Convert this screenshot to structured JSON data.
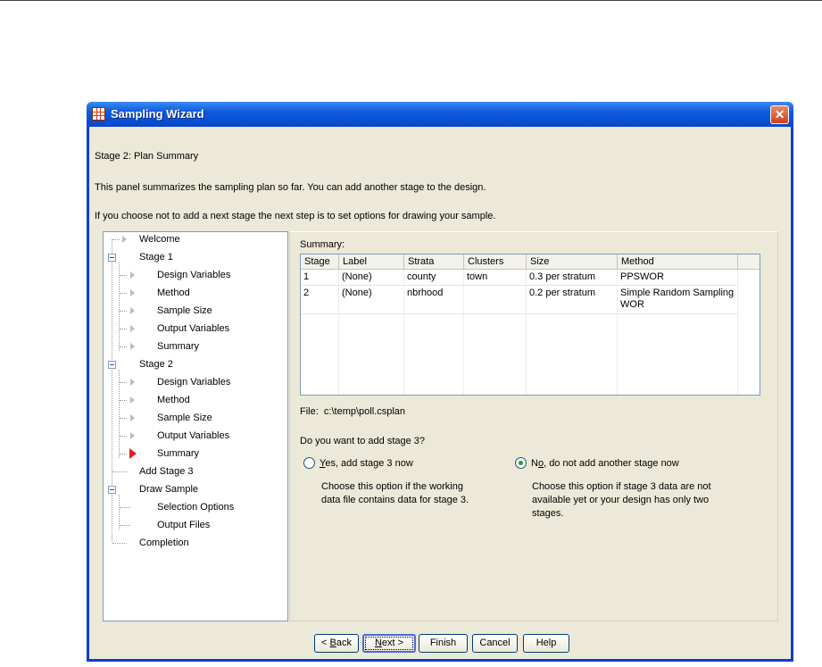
{
  "window": {
    "title": "Sampling Wizard",
    "close_glyph": "✕"
  },
  "header": {
    "stage_title": "Stage 2: Plan Summary",
    "intro": "This panel summarizes the sampling plan so far. You can add another stage to the design.",
    "note": "If you choose not to add a next stage the next step is to set options for drawing your sample."
  },
  "tree": {
    "welcome": "Welcome",
    "stage1": "Stage 1",
    "s1_design": "Design Variables",
    "s1_method": "Method",
    "s1_size": "Sample Size",
    "s1_output": "Output Variables",
    "s1_summary": "Summary",
    "stage2": "Stage 2",
    "s2_design": "Design Variables",
    "s2_method": "Method",
    "s2_size": "Sample Size",
    "s2_output": "Output Variables",
    "s2_summary": "Summary",
    "add_stage3": "Add Stage 3",
    "draw_sample": "Draw Sample",
    "selection_options": "Selection Options",
    "output_files": "Output Files",
    "completion": "Completion"
  },
  "summary": {
    "label": "Summary:",
    "columns": [
      "Stage",
      "Label",
      "Strata",
      "Clusters",
      "Size",
      "Method"
    ],
    "rows": [
      [
        "1",
        "(None)",
        "county",
        "town",
        "0.3 per stratum",
        "PPSWOR"
      ],
      [
        "2",
        "(None)",
        "nbrhood",
        "",
        "0.2 per stratum",
        "Simple Random Sampling WOR"
      ]
    ]
  },
  "file": {
    "label": "File:",
    "path": "c:\\temp\\poll.csplan"
  },
  "question": "Do you want to add stage 3?",
  "option_yes": {
    "label_underlined": "Y",
    "label_rest": "es, add stage 3 now",
    "desc_line1": "Choose this option if the working",
    "desc_line2": "data file contains data for stage 3.",
    "selected": false
  },
  "option_no": {
    "label_first": "N",
    "label_underlined": "o",
    "label_rest": ", do not add another stage now",
    "desc_line1": "Choose this option if stage 3 data are not",
    "desc_line2": "available yet or your design has only two",
    "desc_line3": "stages.",
    "selected": true
  },
  "buttons": {
    "back_prefix": "< ",
    "back_u": "B",
    "back_rest": "ack",
    "next_u": "N",
    "next_rest": "ext >",
    "finish": "Finish",
    "cancel": "Cancel",
    "help": "Help"
  }
}
